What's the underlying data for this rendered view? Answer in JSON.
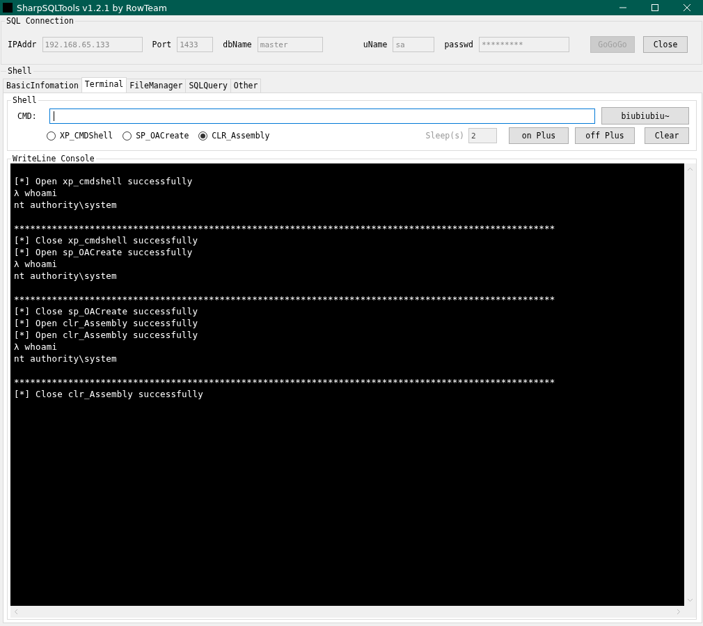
{
  "window": {
    "title": "SharpSQLTools v1.2.1 by RowTeam"
  },
  "connection": {
    "title": "SQL Connection",
    "fields": [
      {
        "label": "IPAddr",
        "value": "192.168.65.133"
      },
      {
        "label": "Port",
        "value": "1433"
      },
      {
        "label": "dbName",
        "value": "master"
      },
      {
        "label": "uName",
        "value": "sa"
      },
      {
        "label": "passwd",
        "value": "*********"
      }
    ],
    "buttons": [
      {
        "label": "GoGoGo",
        "disabled": true
      },
      {
        "label": "Close",
        "disabled": false
      }
    ]
  },
  "shell_group": {
    "title": "Shell"
  },
  "tabs": [
    {
      "label": "BasicInfomation",
      "selected": false
    },
    {
      "label": "Terminal",
      "selected": true
    },
    {
      "label": "FileManager",
      "selected": false
    },
    {
      "label": "SQLQuery",
      "selected": false
    },
    {
      "label": "Other",
      "selected": false
    }
  ],
  "shell": {
    "title": "Shell",
    "cmd_label": "CMD:",
    "run_button": "biubiubiu~",
    "modes": [
      {
        "label": "XP_CMDShell",
        "selected": false
      },
      {
        "label": "SP_OACreate",
        "selected": false
      },
      {
        "label": "CLR_Assembly",
        "selected": true
      }
    ],
    "sleep_label": "Sleep(s)",
    "sleep_value": "2",
    "buttons": [
      "on Plus",
      "off Plus",
      "Clear"
    ]
  },
  "console": {
    "title": "WriteLine Console",
    "blocks": [
      [
        "[*] Open xp_cmdshell successfully",
        "λ whoami",
        "nt authority\\system"
      ],
      [
        "****************************************************************************************************",
        "[*] Close xp_cmdshell successfully",
        "[*] Open sp_OACreate successfully",
        "λ whoami",
        "nt authority\\system"
      ],
      [
        "****************************************************************************************************",
        "[*] Close sp_OACreate successfully",
        "[*] Open clr_Assembly successfully",
        "[*] Open clr_Assembly successfully",
        "λ whoami",
        "nt authority\\system"
      ],
      [
        "****************************************************************************************************",
        "[*] Close clr_Assembly successfully"
      ]
    ]
  }
}
